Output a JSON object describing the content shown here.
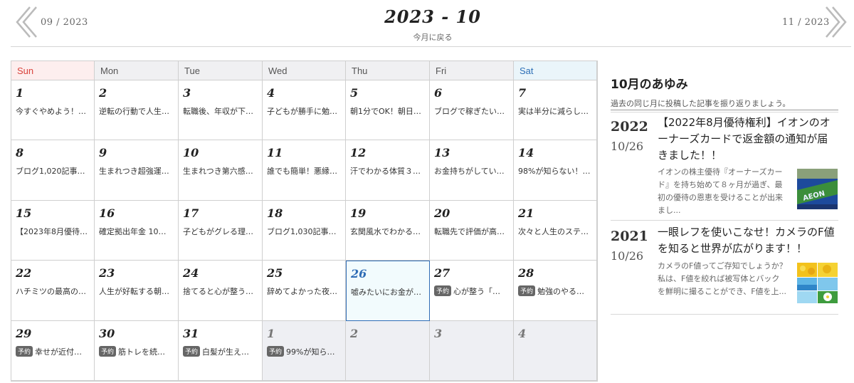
{
  "header": {
    "title": "2023 - 10",
    "back_today": "今月に戻る",
    "prev_label": "09 / 2023",
    "next_label": "11 / 2023",
    "prev_icon": "chevron-left-icon",
    "next_icon": "chevron-right-icon"
  },
  "calendar": {
    "weekdays": [
      "Sun",
      "Mon",
      "Tue",
      "Wed",
      "Thu",
      "Fri",
      "Sat"
    ],
    "today": 26,
    "badge_label": "予約",
    "weeks": [
      [
        {
          "day": "1",
          "post": "今すぐやめよう！…"
        },
        {
          "day": "2",
          "post": "逆転の行動で人生…"
        },
        {
          "day": "3",
          "post": "転職後、年収が下…"
        },
        {
          "day": "4",
          "post": "子どもが勝手に勉…"
        },
        {
          "day": "5",
          "post": "朝1分でOK！朝日…"
        },
        {
          "day": "6",
          "post": "ブログで稼ぎたい…"
        },
        {
          "day": "7",
          "post": "実は半分に減らし…"
        }
      ],
      [
        {
          "day": "8",
          "post": "ブログ1,020記事…"
        },
        {
          "day": "9",
          "post": "生まれつき超強運…"
        },
        {
          "day": "10",
          "post": "生まれつき第六感…"
        },
        {
          "day": "11",
          "post": "誰でも簡単！悪縁…"
        },
        {
          "day": "12",
          "post": "汗でわかる体質３…"
        },
        {
          "day": "13",
          "post": "お金持ちがしてい…"
        },
        {
          "day": "14",
          "post": "98%が知らない！…"
        }
      ],
      [
        {
          "day": "15",
          "post": "【2023年8月優待…"
        },
        {
          "day": "16",
          "post": "確定拠出年金 10…"
        },
        {
          "day": "17",
          "post": "子どもがグレる理…"
        },
        {
          "day": "18",
          "post": "ブログ1,030記事…"
        },
        {
          "day": "19",
          "post": "玄関風水でわかる…"
        },
        {
          "day": "20",
          "post": "転職先で評価が高…"
        },
        {
          "day": "21",
          "post": "次々と人生のステ…"
        }
      ],
      [
        {
          "day": "22",
          "post": "ハチミツの最高の…"
        },
        {
          "day": "23",
          "post": "人生が好転する朝…"
        },
        {
          "day": "24",
          "post": "捨てると心が整う…"
        },
        {
          "day": "25",
          "post": "辞めてよかった夜…"
        },
        {
          "day": "26",
          "post": "嘘みたいにお金が…",
          "today": true
        },
        {
          "day": "27",
          "post": "心が整う「…",
          "badge": true
        },
        {
          "day": "28",
          "post": "勉強のやる…",
          "badge": true
        }
      ],
      [
        {
          "day": "29",
          "post": "幸せが近付…",
          "badge": true
        },
        {
          "day": "30",
          "post": "筋トレを続…",
          "badge": true
        },
        {
          "day": "31",
          "post": "白髪が生え…",
          "badge": true
        },
        {
          "day": "1",
          "post": "99%が知ら…",
          "badge": true,
          "other": true
        },
        {
          "day": "2",
          "post": "",
          "other": true
        },
        {
          "day": "3",
          "post": "",
          "other": true
        },
        {
          "day": "4",
          "post": "",
          "other": true
        }
      ]
    ]
  },
  "sidebar": {
    "title": "10月のあゆみ",
    "subtitle": "過去の同じ月に投稿した記事を振り返りましょう。",
    "entries": [
      {
        "year": "2022",
        "date": "10/26",
        "title": "【2022年8月優待権利】イオンのオーナーズカードで返金額の通知が届きました！！",
        "excerpt": "イオンの株主優待『オーナーズカード』を持ち始めて８ヶ月が過ぎ、最初の優待の恩恵を受けることが出来まし...",
        "thumb": "aeon-card-thumbnail"
      },
      {
        "year": "2021",
        "date": "10/26",
        "title": "一眼レフを使いこなせ！カメラのF値を知ると世界が広がります！！",
        "excerpt": "カメラのF値ってご存知でしょうか？ 私は、F値を絞れば被写体とバックを鮮明に撮ることができ、F値を上...",
        "thumb": "camera-photo-thumbnail"
      }
    ]
  }
}
